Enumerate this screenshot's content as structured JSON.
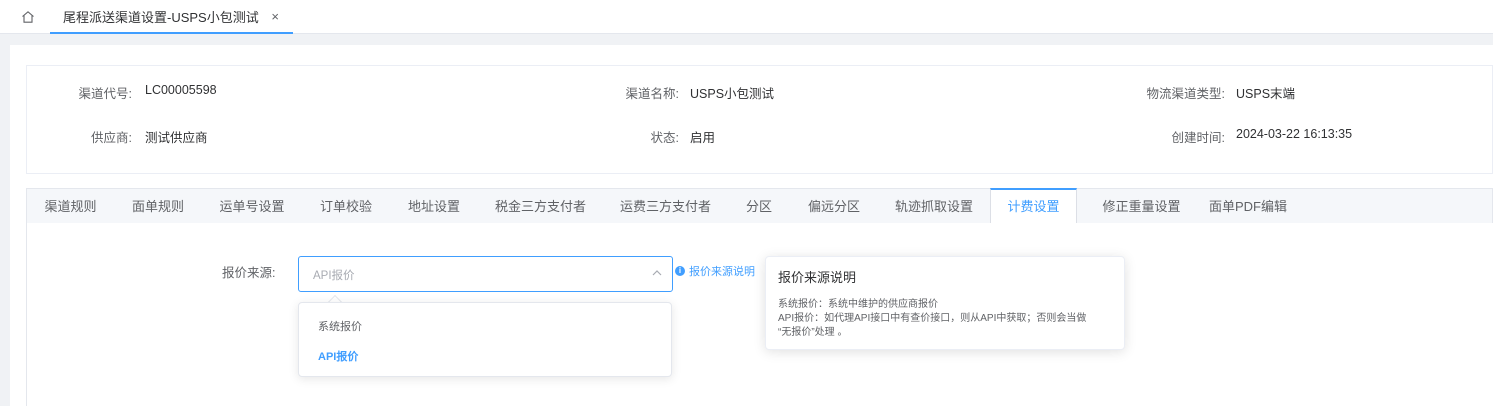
{
  "tabbar": {
    "home_icon": "home-icon",
    "tab_title": "尾程派送渠道设置-USPS小包测试",
    "close_glyph": "×"
  },
  "info": {
    "channel_code_label": "渠道代号:",
    "channel_code": "LC00005598",
    "channel_name_label": "渠道名称:",
    "channel_name": "USPS小包测试",
    "channel_type_label": "物流渠道类型:",
    "channel_type": "USPS末端",
    "supplier_label": "供应商:",
    "supplier": "测试供应商",
    "status_label": "状态:",
    "status": "启用",
    "created_label": "创建时间:",
    "created": "2024-03-22 16:13:35"
  },
  "subtabs": [
    {
      "label": "渠道规则"
    },
    {
      "label": "面单规则"
    },
    {
      "label": "运单号设置"
    },
    {
      "label": "订单校验"
    },
    {
      "label": "地址设置"
    },
    {
      "label": "税金三方支付者"
    },
    {
      "label": "运费三方支付者"
    },
    {
      "label": "分区"
    },
    {
      "label": "偏远分区"
    },
    {
      "label": "轨迹抓取设置"
    },
    {
      "label": "计费设置",
      "active": true
    },
    {
      "label": "修正重量设置"
    },
    {
      "label": "面单PDF编辑"
    }
  ],
  "form": {
    "quote_source_label": "报价来源:",
    "quote_source_placeholder": "API报价",
    "help_link": "报价来源说明",
    "options": [
      "系统报价",
      "API报价"
    ],
    "selected_option": "API报价"
  },
  "tooltip": {
    "title": "报价来源说明",
    "line1": "系统报价：系统中维护的供应商报价",
    "line2": "API报价：如代理API接口中有查价接口，则从API中获取；否则会当做",
    "line3": "“无报价”处理 。"
  },
  "colors": {
    "accent": "#409eff",
    "text_primary": "#303133",
    "text_secondary": "#606266"
  }
}
